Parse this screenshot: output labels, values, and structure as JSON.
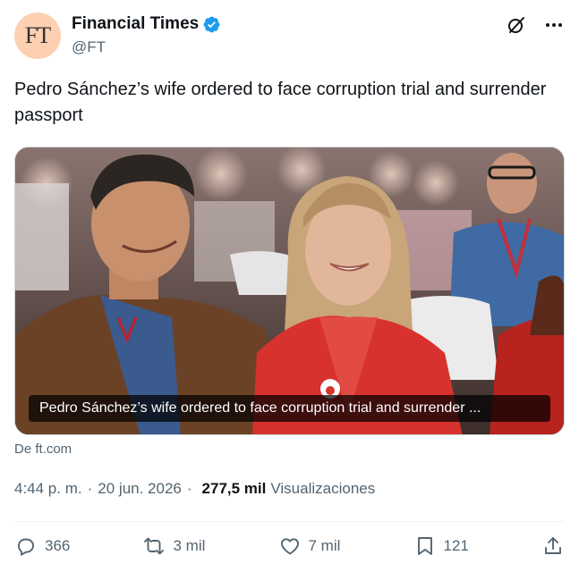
{
  "header": {
    "avatar_text": "FT",
    "display_name": "Financial Times",
    "handle": "@FT",
    "verified_color": "#1d9bf0"
  },
  "tweet": {
    "text": "Pedro Sánchez’s wife ordered to face corruption trial and surrender passport"
  },
  "media": {
    "caption": "Pedro Sánchez’s wife ordered to face corruption trial and surrender ...",
    "source": "De ft.com"
  },
  "meta": {
    "time": "4:44 p. m.",
    "separator": "·",
    "date": "20 jun. 2026",
    "views_count": "277,5 mil",
    "views_label": "Visualizaciones"
  },
  "actions": {
    "replies": "366",
    "reposts": "3 mil",
    "likes": "7 mil",
    "bookmarks": "121"
  },
  "icons": {
    "verified": "verified-badge-icon",
    "grok": "grok-icon",
    "more": "more-icon",
    "reply": "reply-icon",
    "repost": "repost-icon",
    "like": "heart-icon",
    "bookmark": "bookmark-icon",
    "share": "share-icon"
  }
}
